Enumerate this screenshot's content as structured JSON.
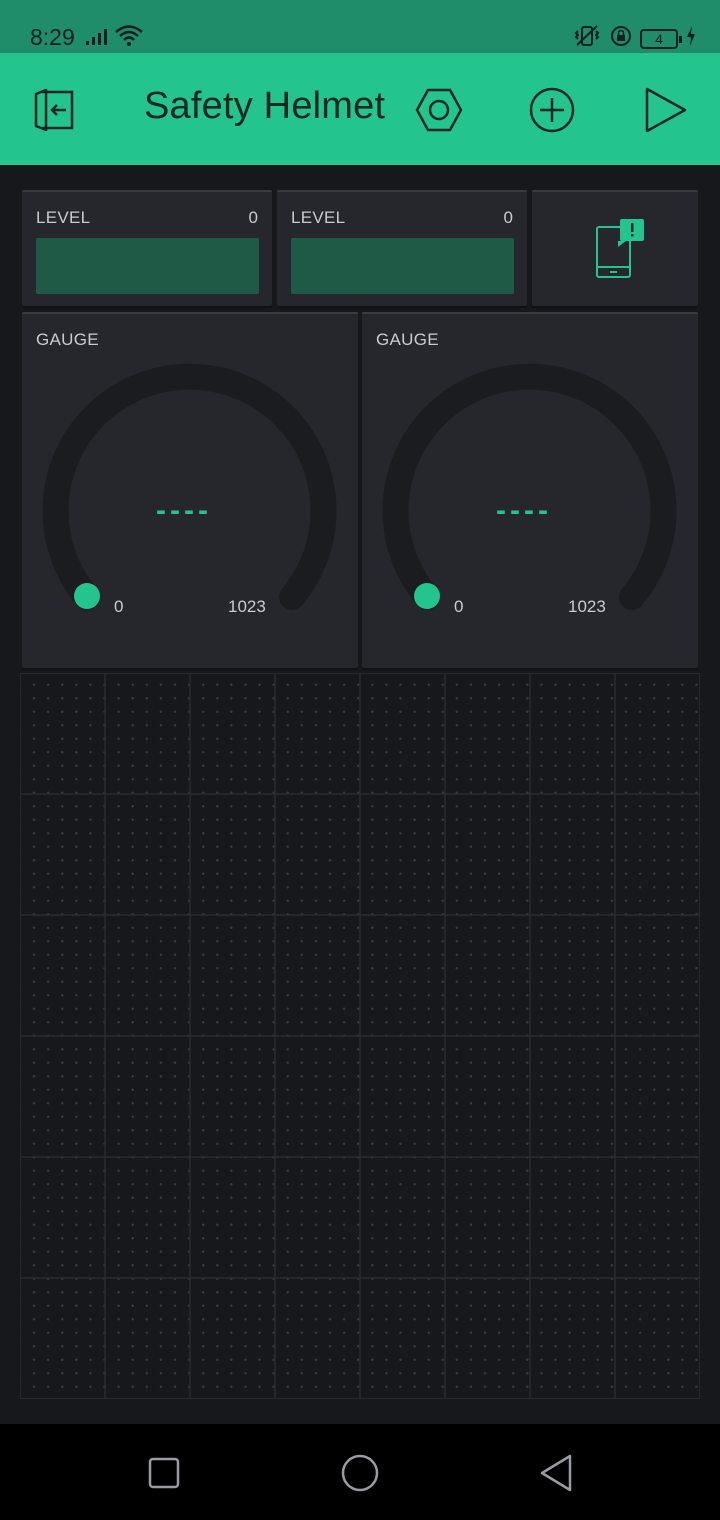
{
  "status_bar": {
    "time": "8:29",
    "battery": "4",
    "icons": [
      "signal-icon",
      "wifi-icon",
      "vibrate-icon",
      "rotation-lock-icon",
      "battery-icon",
      "charging-icon"
    ]
  },
  "toolbar": {
    "title": "Safety Helmet",
    "icons": [
      "exit-icon",
      "settings-hexagon-icon",
      "add-widget-icon",
      "play-icon"
    ]
  },
  "widgets": {
    "level_1": {
      "label": "LEVEL",
      "value": "0"
    },
    "level_2": {
      "label": "LEVEL",
      "value": "0"
    },
    "notification": {
      "icon": "phone-notification-icon"
    },
    "gauge_1": {
      "label": "GAUGE",
      "value": "----",
      "min": "0",
      "max": "1023"
    },
    "gauge_2": {
      "label": "GAUGE",
      "value": "----",
      "min": "0",
      "max": "1023"
    }
  },
  "colors": {
    "accent": "#23c48e",
    "status_bar": "#1f8c6a",
    "widget_bg": "#26272c",
    "canvas_bg": "#17181c",
    "level_fill": "#1f5a47"
  },
  "nav_bar": {
    "icons": [
      "recents-square-icon",
      "home-circle-icon",
      "back-triangle-icon"
    ]
  }
}
